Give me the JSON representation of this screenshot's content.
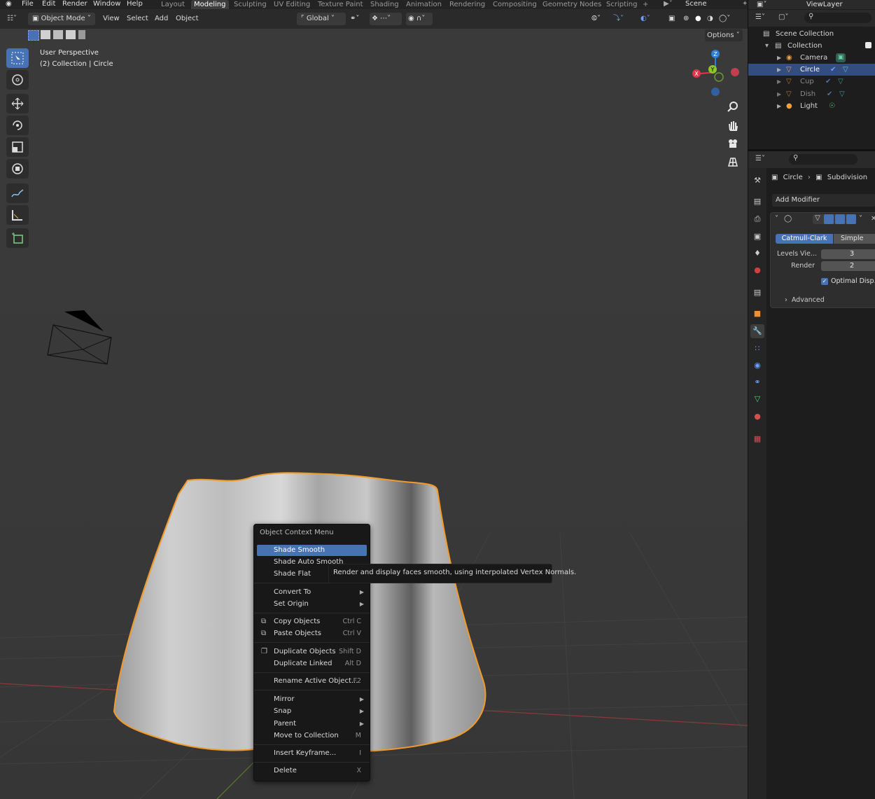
{
  "topbar": {
    "menu": [
      "File",
      "Edit",
      "Render",
      "Window",
      "Help"
    ],
    "workspaces": [
      "Layout",
      "Modeling",
      "Sculpting",
      "UV Editing",
      "Texture Paint",
      "Shading",
      "Animation",
      "Rendering",
      "Compositing",
      "Geometry Nodes",
      "Scripting"
    ],
    "active_workspace": "Modeling",
    "add_tab": "+",
    "scene": "Scene",
    "view_layer": "ViewLayer"
  },
  "viewport_header": {
    "mode": "Object Mode",
    "menus": [
      "View",
      "Select",
      "Add",
      "Object"
    ],
    "orientation": "Global",
    "options": "Options"
  },
  "viewport": {
    "perspective": "User Perspective",
    "collection_info": "(2) Collection | Circle",
    "gizmo": {
      "z": "Z",
      "y": "Y",
      "x": "X"
    }
  },
  "context_menu": {
    "title": "Object Context Menu",
    "items": [
      {
        "label": "Shade Smooth",
        "shortcut": "",
        "submenu": false,
        "highlighted": true
      },
      {
        "label": "Shade Auto Smooth",
        "shortcut": "",
        "submenu": false
      },
      {
        "label": "Shade Flat",
        "shortcut": "",
        "submenu": false
      },
      {
        "label": "Convert To",
        "shortcut": "",
        "submenu": true
      },
      {
        "label": "Set Origin",
        "shortcut": "",
        "submenu": true
      },
      {
        "label": "Copy Objects",
        "shortcut": "Ctrl C",
        "submenu": false,
        "icon": "copy-icon"
      },
      {
        "label": "Paste Objects",
        "shortcut": "Ctrl V",
        "submenu": false,
        "icon": "paste-icon"
      },
      {
        "label": "Duplicate Objects",
        "shortcut": "Shift D",
        "submenu": false,
        "icon": "duplicate-icon"
      },
      {
        "label": "Duplicate Linked",
        "shortcut": "Alt D",
        "submenu": false
      },
      {
        "label": "Rename Active Object...",
        "shortcut": "F2",
        "submenu": false
      },
      {
        "label": "Mirror",
        "shortcut": "",
        "submenu": true
      },
      {
        "label": "Snap",
        "shortcut": "",
        "submenu": true
      },
      {
        "label": "Parent",
        "shortcut": "",
        "submenu": true
      },
      {
        "label": "Move to Collection",
        "shortcut": "M",
        "submenu": false
      },
      {
        "label": "Insert Keyframe...",
        "shortcut": "I",
        "submenu": false
      },
      {
        "label": "Delete",
        "shortcut": "X",
        "submenu": false
      }
    ],
    "tooltip": "Render and display faces smooth, using interpolated Vertex Normals."
  },
  "outliner": {
    "scene_collection": "Scene Collection",
    "collection": "Collection",
    "objects": [
      {
        "name": "Camera",
        "selected": false,
        "dim": false
      },
      {
        "name": "Circle",
        "selected": true,
        "dim": false
      },
      {
        "name": "Cup",
        "selected": false,
        "dim": true
      },
      {
        "name": "Dish",
        "selected": false,
        "dim": true
      },
      {
        "name": "Light",
        "selected": false,
        "dim": false
      }
    ]
  },
  "properties": {
    "breadcrumb_object": "Circle",
    "breadcrumb_modifier": "Subdivision",
    "add_modifier": "Add Modifier",
    "subdivision": {
      "type_active": "Catmull-Clark",
      "type_other": "Simple",
      "levels_viewport_label": "Levels Vie...",
      "levels_viewport": "3",
      "render_label": "Render",
      "render": "2",
      "optimal_display": "Optimal Disp...",
      "optimal_display_checked": true,
      "advanced": "Advanced"
    }
  },
  "colors": {
    "accent": "#4772b3",
    "selection_outline": "#f29a2a",
    "axis_x": "#e0354b",
    "axis_y": "#8bc726",
    "axis_z": "#2f7fd8"
  }
}
